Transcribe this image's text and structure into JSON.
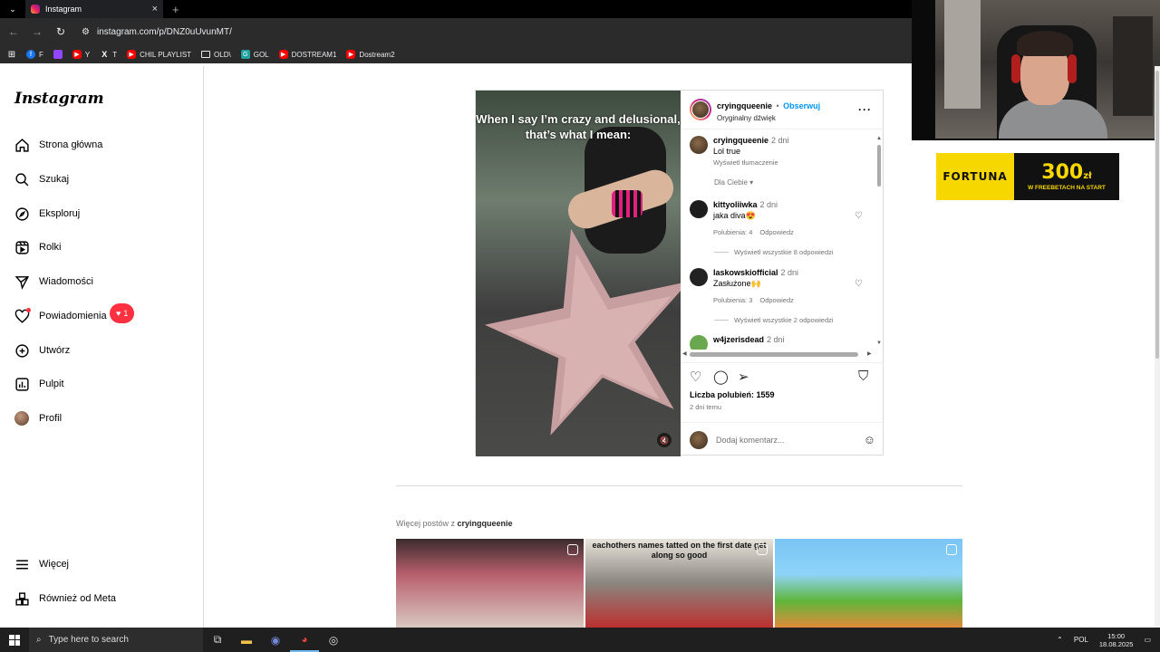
{
  "browser": {
    "tab_title": "Instagram",
    "url": "instagram.com/p/DNZ0uUvunMT/",
    "bookmarks": [
      {
        "label": "F",
        "icon": "facebook-icon"
      },
      {
        "label": "",
        "icon": "twitch-icon"
      },
      {
        "label": "Y",
        "icon": "youtube-icon"
      },
      {
        "label": "T",
        "icon": "x-icon"
      },
      {
        "label": "CHIL PLAYLIST",
        "icon": "youtube-icon"
      },
      {
        "label": "OLD\\",
        "icon": "folder-icon"
      },
      {
        "label": "GOL",
        "icon": "g-icon"
      },
      {
        "label": "DOSTREAM1",
        "icon": "youtube-icon"
      },
      {
        "label": "Dostream2",
        "icon": "youtube-icon"
      }
    ]
  },
  "promo": {
    "brand": "FORTUNA",
    "amount": "300",
    "currency": "zł",
    "subtitle": "W FREEBETACH NA START"
  },
  "sidebar": {
    "logo": "Instagram",
    "items": [
      {
        "label": "Strona główna"
      },
      {
        "label": "Szukaj"
      },
      {
        "label": "Eksploruj"
      },
      {
        "label": "Rolki"
      },
      {
        "label": "Wiadomości"
      },
      {
        "label": "Powiadomienia"
      },
      {
        "label": "Utwórz"
      },
      {
        "label": "Pulpit"
      },
      {
        "label": "Profil"
      }
    ],
    "notif_count": "1",
    "more": "Więcej",
    "meta": "Również od Meta"
  },
  "post": {
    "media_caption": "When I say I’m crazy and delusional, that’s what I mean:",
    "author": "cryingqueenie",
    "separator": "•",
    "follow": "Obserwuj",
    "audio": "Oryginalny dźwięk",
    "comments": [
      {
        "user": "cryingqueenie",
        "time": "2 dni",
        "text": "Lol true",
        "translate": "Wyświetl tłumaczenie",
        "avatar_color": "#4a3a2a"
      },
      {
        "user": "kittyoliiwka",
        "time": "2 dni",
        "text": "jaka diva😍",
        "likes": "Polubienia: 4",
        "reply": "Odpowiedz",
        "view_replies": "Wyświetl wszystkie 8 odpowiedzi",
        "avatar_color": "#1d1d1d"
      },
      {
        "user": "laskowskiofficial",
        "time": "2 dni",
        "text": "Zasłużone🙌",
        "likes": "Polubienia: 3",
        "reply": "Odpowiedz",
        "view_replies": "Wyświetl wszystkie 2 odpowiedzi",
        "avatar_color": "#222222"
      },
      {
        "user": "w4jzerisdead",
        "time": "2 dni",
        "avatar_color": "#6aa84f"
      }
    ],
    "for_you": "Dla Ciebie ▾",
    "likes_count": "Liczba polubień: 1559",
    "posted": "2 dni temu",
    "add_comment_placeholder": "Dodaj komentarz..."
  },
  "more_posts": {
    "prefix": "Więcej postów z",
    "user": "cryingqueenie",
    "thumb2_text": "eachothers names tatted on the first date get along so good"
  },
  "taskbar": {
    "search_placeholder": "Type here to search",
    "lang": "POL",
    "time": "15:00",
    "date": "18.08.2025"
  }
}
